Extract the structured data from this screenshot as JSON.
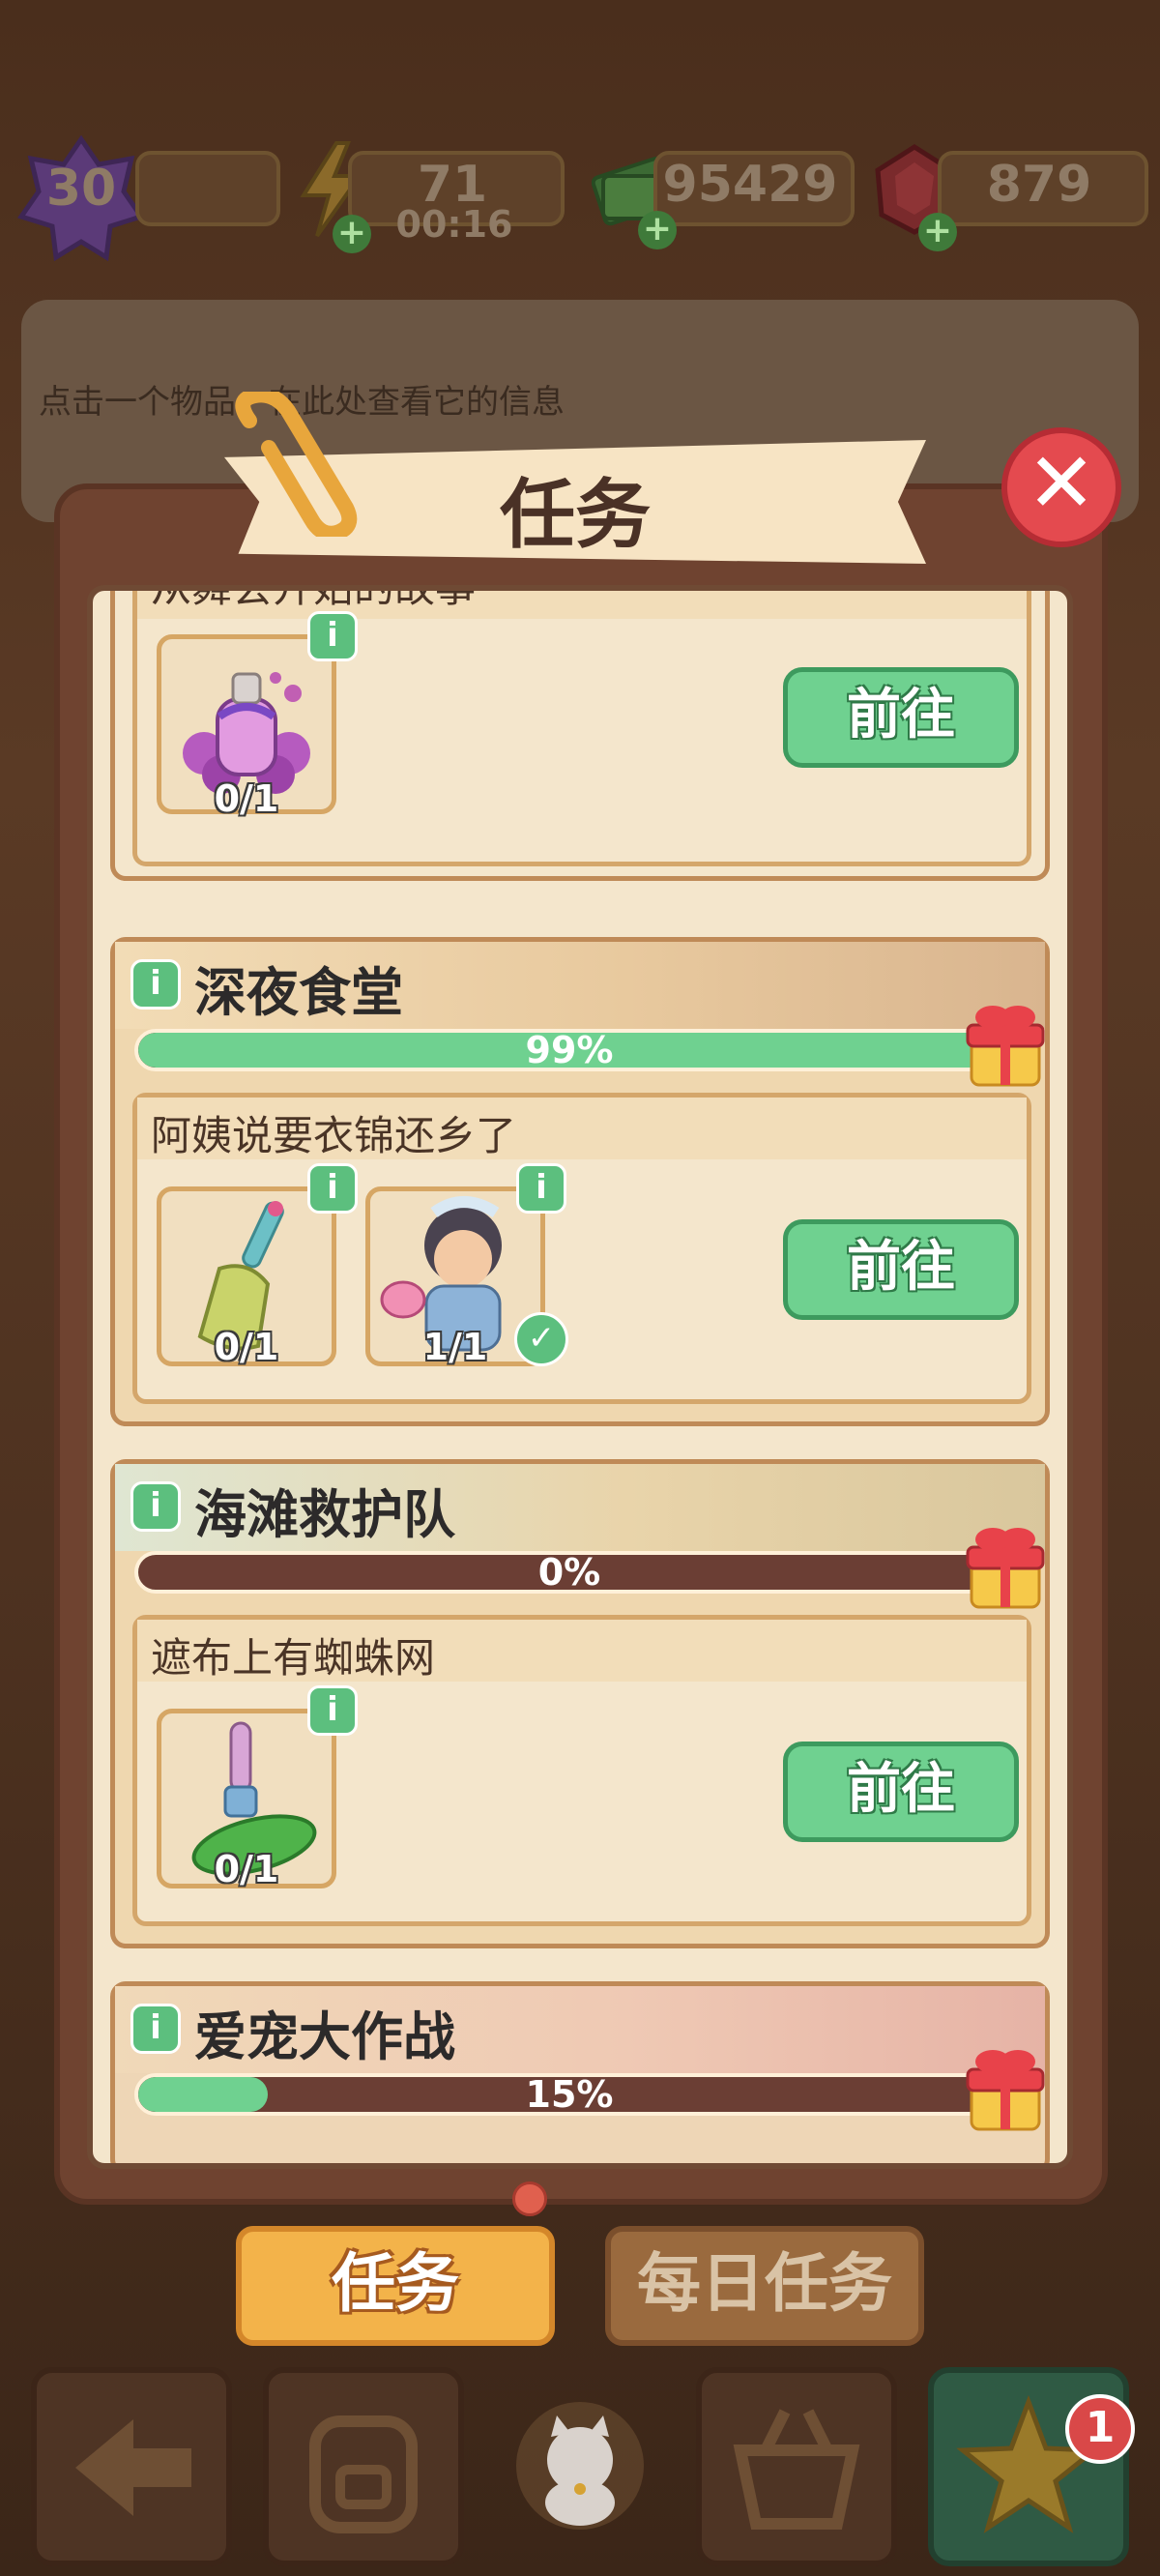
{
  "topbar": {
    "level": "30",
    "energy": "71",
    "energy_timer": "00:16",
    "cash": "95429",
    "gems": "879"
  },
  "info_panel": {
    "text": "点击一个物品，在此处查看它的信息"
  },
  "dialog": {
    "title": "任务"
  },
  "sections": [
    {
      "name": "",
      "task": {
        "title": "从舞会开始的故事",
        "items": [
          {
            "icon": "perfume-bottle-icon",
            "count": "0/1"
          }
        ],
        "go_label": "前往"
      }
    },
    {
      "name": "深夜食堂",
      "progress": 0.99,
      "progress_label": "99%",
      "task": {
        "title": "阿姨说要衣锦还乡了",
        "items": [
          {
            "icon": "broom-icon",
            "count": "0/1"
          },
          {
            "icon": "aunt-character-icon",
            "count": "1/1",
            "done": true
          }
        ],
        "go_label": "前往"
      }
    },
    {
      "name": "海滩救护队",
      "progress": 0.0,
      "progress_label": "0%",
      "task": {
        "title": "遮布上有蜘蛛网",
        "items": [
          {
            "icon": "brush-icon",
            "count": "0/1"
          }
        ],
        "go_label": "前往"
      }
    },
    {
      "name": "爱宠大作战",
      "progress": 0.15,
      "progress_label": "15%"
    }
  ],
  "tabs": {
    "tasks": "任务",
    "daily": "每日任务"
  },
  "nav": {
    "badge": "1"
  },
  "colors": {
    "accent_green": "#6fd190",
    "close_red": "#e44a4f",
    "tab_orange": "#f3b34a"
  }
}
